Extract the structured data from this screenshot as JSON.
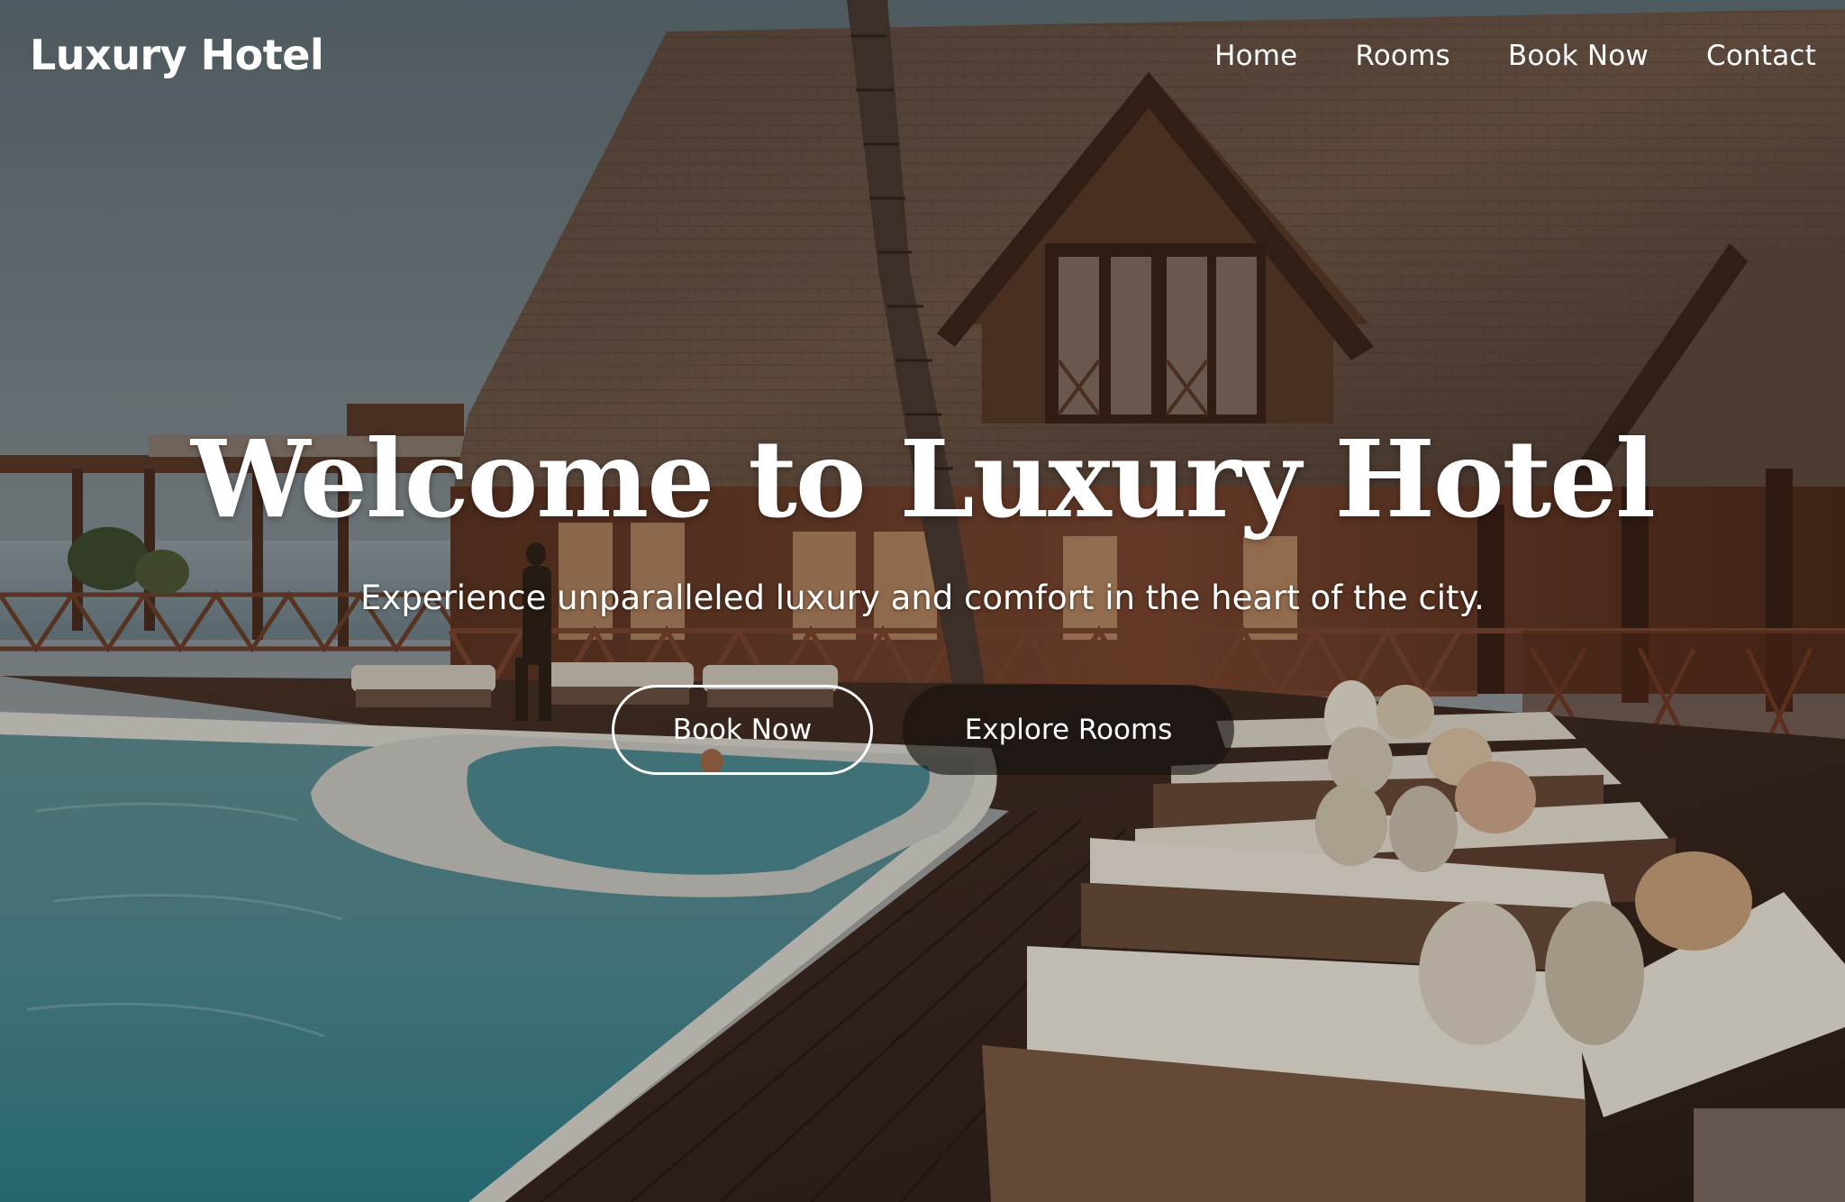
{
  "header": {
    "logo": "Luxury Hotel",
    "nav": [
      "Home",
      "Rooms",
      "Book Now",
      "Contact"
    ]
  },
  "hero": {
    "title": "Welcome to Luxury Hotel",
    "subtitle": "Experience unparalleled luxury and comfort in the heart of the city.",
    "primary_button": "Book Now",
    "secondary_button": "Explore Rooms"
  },
  "colors": {
    "text": "#ffffff",
    "roof": "#6a5548",
    "wood": "#5a3524",
    "deck": "#3a2820",
    "pool": "#5e8e95",
    "sky": "#7a8a92"
  }
}
